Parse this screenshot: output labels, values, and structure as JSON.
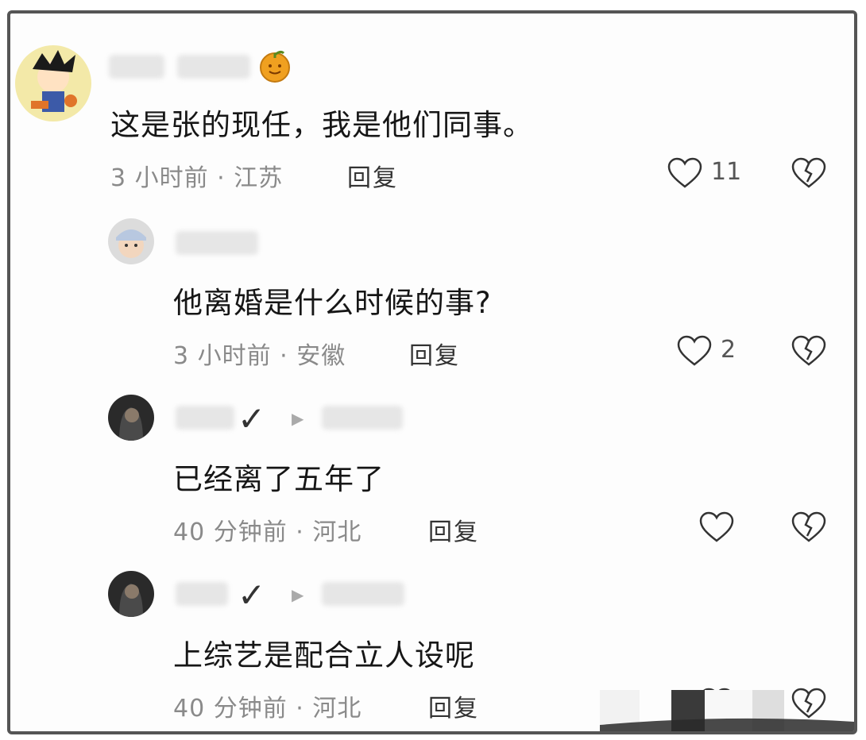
{
  "comments": [
    {
      "content": "这是张的现任，我是他们同事。",
      "meta": "3 小时前 · 江苏",
      "reply": "回复",
      "likes": "11",
      "badge": "orange-emoji"
    },
    {
      "content": "他离婚是什么时候的事?",
      "meta": "3 小时前 · 安徽",
      "reply": "回复",
      "likes": "2"
    },
    {
      "content": "已经离了五年了",
      "meta": "40 分钟前 · 河北",
      "reply": "回复",
      "likes": "",
      "verified": "✓"
    },
    {
      "content": "上综艺是配合立人设呢",
      "meta": "40 分钟前 · 河北",
      "reply": "回复",
      "likes": "",
      "verified": "✓"
    }
  ],
  "icons": {
    "like": "heart-outline-icon",
    "dislike": "broken-heart-icon",
    "reply_arrow": "play-triangle-icon"
  },
  "colors": {
    "text": "#161616",
    "meta": "#8a8a8a",
    "border": "#555555",
    "badge": "#f0a020"
  }
}
